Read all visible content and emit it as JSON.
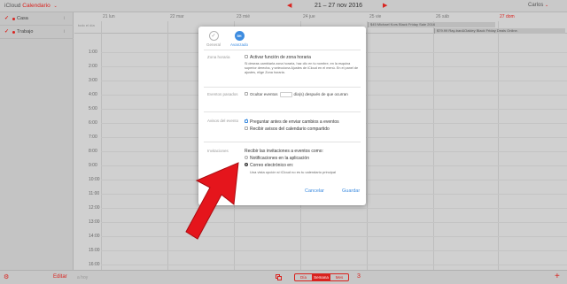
{
  "topbar": {
    "brand": "iCloud",
    "app_name": "Calendario",
    "week_range": "21 – 27 nov 2016",
    "prev_arrow": "◀",
    "next_arrow": "▶",
    "user": "Carlos"
  },
  "sidebar": {
    "items": [
      {
        "label": "Casa",
        "checked": "✓",
        "info": "i",
        "color": "#d9231f"
      },
      {
        "label": "Trabajo",
        "checked": "✓",
        "info": "i",
        "color": "#d9231f"
      }
    ]
  },
  "grid": {
    "days": [
      "21 lun",
      "22 mar",
      "23 mié",
      "24 jue",
      "25 vie",
      "26 sáb",
      "27 dom"
    ],
    "allday_label": "todo el día",
    "hours": [
      "1:00",
      "2:00",
      "3:00",
      "4:00",
      "5:00",
      "6:00",
      "7:00",
      "8:00",
      "9:00",
      "10:00",
      "11:00",
      "12:00",
      "13:00",
      "14:00",
      "15:00",
      "16:00",
      "17:00"
    ],
    "events": [
      "$45 Michael Kors Black Friday Sale 2016",
      "$79.99 Ray-ban&Oakley Black Friday Deals Online."
    ]
  },
  "bottombar": {
    "edit_label": "Editar",
    "todo_hint": "a hoy",
    "views": [
      "Día",
      "Semana",
      "Mes"
    ],
    "active_view": "Semana",
    "today_number": "3",
    "add_label": "+"
  },
  "dialog": {
    "tabs": [
      {
        "label": "General",
        "icon": "✓"
      },
      {
        "label": "Avanzado",
        "icon": "5H"
      }
    ],
    "timezone": {
      "label": "Zona horaria",
      "option": "Activar función de zona horaria",
      "description": "Si deseas cambiarla zona horaria, haz clic en tu nombre, en la esquina superior derecha, y selecciona Ajustes de iCloud en el menú. En el panel de ajustes, elige Zona horaria."
    },
    "past_events": {
      "label": "Eventos pasados",
      "option_prefix": "Ocultar eventos",
      "option_suffix": "día(s) después de que ocurran"
    },
    "event_alerts": {
      "label": "Avisos del evento",
      "options": [
        "Preguntar antes de enviar cambios a eventos",
        "Recibir avisos del calendario compartido"
      ]
    },
    "invitations": {
      "label": "Invitaciones",
      "intro": "Recibir las invitaciones a eventos como:",
      "options": [
        "Notificaciones en la aplicación",
        "Correo electrónico en:"
      ],
      "hint": "Una vista opción si iCloud no es tu calendario principal"
    },
    "cancel_label": "Cancelar",
    "save_label": "Guardar"
  },
  "colors": {
    "accent_red": "#d9231f",
    "link_blue": "#3d8ce0",
    "arrow_red": "#e5151c"
  },
  "icons": {
    "gear": "⚙",
    "info": "i",
    "check": "✓"
  }
}
